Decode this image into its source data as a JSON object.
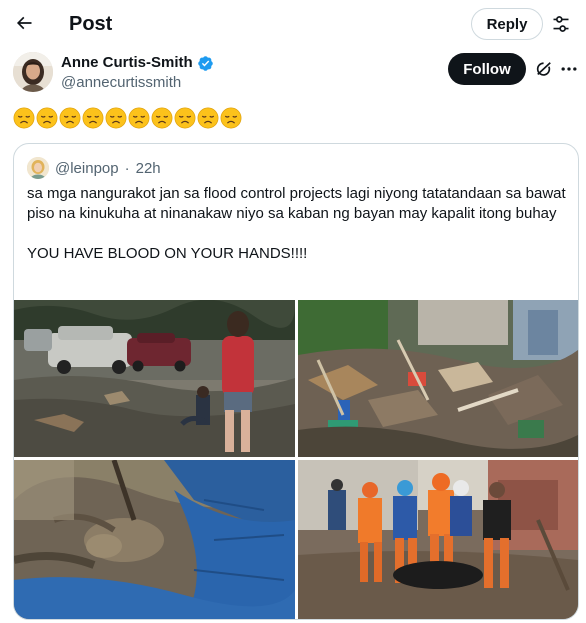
{
  "header": {
    "title": "Post",
    "reply_label": "Reply"
  },
  "author": {
    "display_name": "Anne Curtis-Smith",
    "handle": "@annecurtissmith",
    "verified": true,
    "follow_label": "Follow"
  },
  "post": {
    "emoji_count": 10,
    "emoji_name": "disappointed-face"
  },
  "quote": {
    "handle": "@leinpop",
    "separator": "·",
    "time": "22h",
    "text_line1": "sa mga nangurakot jan sa flood control projects lagi niyong tatatandaan sa bawat piso na kinukuha at ninanakaw niyo sa kaban ng bayan may kapalit itong buhay",
    "text_line2": "YOU HAVE BLOOD ON YOUR HANDS!!!!",
    "media_count": 4
  },
  "colors": {
    "accent_dark": "#0f1419",
    "secondary_text": "#536471",
    "border": "#cfd9de",
    "verified": "#1d9bf0"
  }
}
